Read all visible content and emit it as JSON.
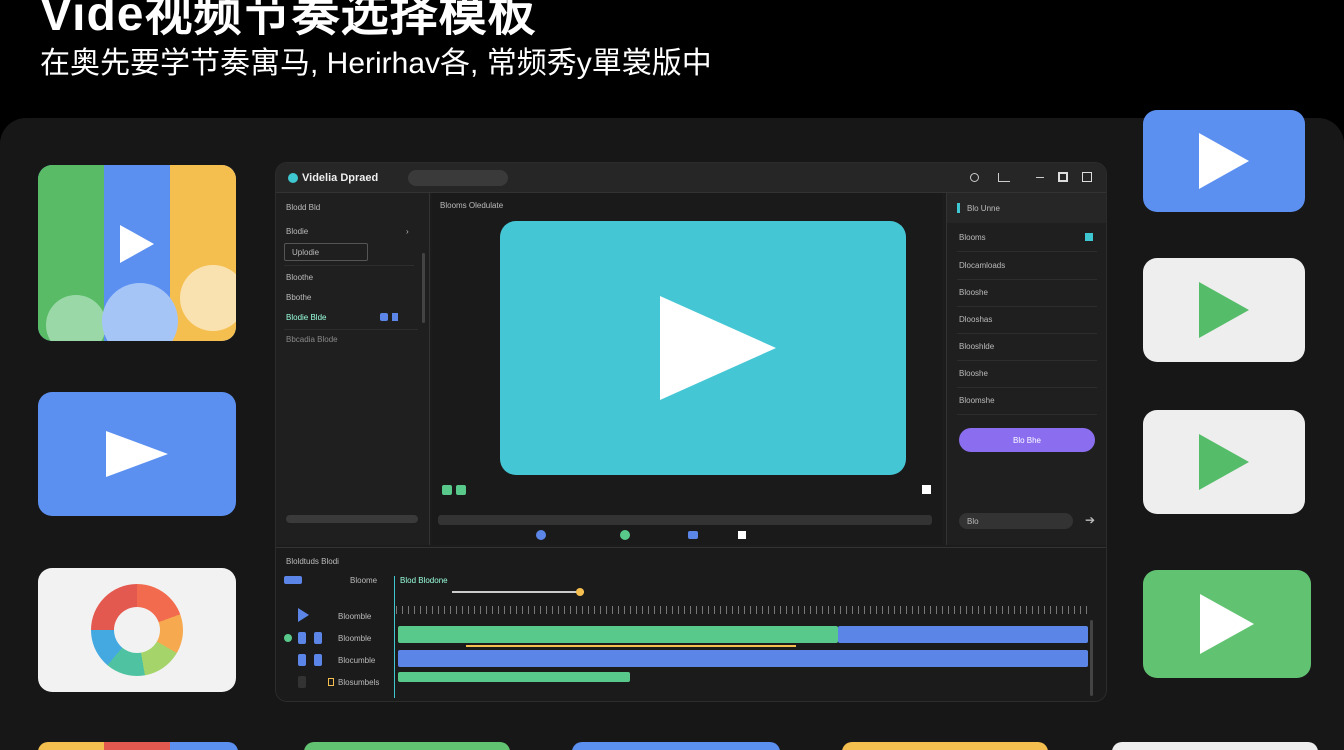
{
  "hero": {
    "title": "Vide视频节奏选择模板",
    "subtitle": "在奥先要学节奏寓马, Herirhav各, 常频秀y單裳版中"
  },
  "app": {
    "title": "Videlia Dpraed",
    "search_value": "",
    "toolbar_text": "Blooms Oledulate",
    "left_panel": {
      "header": "Blodd Bld",
      "items": [
        "Blodie",
        "Uplodie",
        "Bloothe",
        "Bbothe",
        "Blodie Blde"
      ],
      "footer": "Bbcadia Blode"
    },
    "right_panel": {
      "header": "Blo Unne",
      "items": [
        "Blooms",
        "Dlocamloads",
        "Blooshe",
        "Dlooshas",
        "Blooshlde",
        "Blooshe",
        "Bloomshe"
      ],
      "button_label": "Blo Bhe",
      "input_value": "Blo"
    },
    "timeline": {
      "title": "Bloldtuds Blodi",
      "header_tab": "Bloome",
      "tracks": [
        "Bloomble",
        "Bloomble",
        "Blocumble",
        "Blosumbels"
      ],
      "playhead_label": "Blod Blodone"
    }
  },
  "colors": {
    "accent_purple": "#8b6ef0",
    "track_green": "#59c98b",
    "track_blue": "#5b86e8",
    "preview_teal": "#45c6d4",
    "card_blue": "#5b8ff0",
    "card_green": "#61c371",
    "card_yellow": "#f5bf50"
  },
  "icons": [
    "play-icon",
    "color-wheel-icon",
    "play-icon"
  ]
}
